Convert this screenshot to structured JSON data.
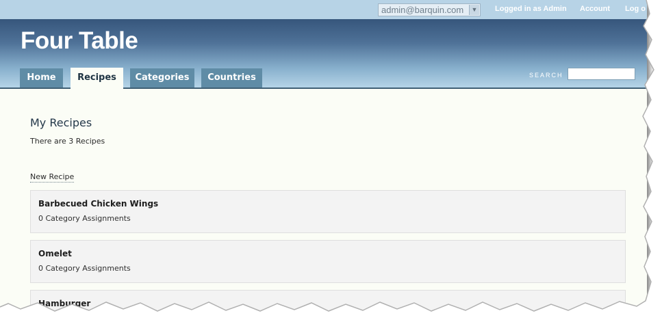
{
  "topbar": {
    "user_select": {
      "value": "admin@barquin.com"
    },
    "logged_in": "Logged in as Admin",
    "account": "Account",
    "logout": "Log o"
  },
  "header": {
    "site_title": "Four Table",
    "tabs": [
      {
        "label": "Home",
        "active": false
      },
      {
        "label": "Recipes",
        "active": true
      },
      {
        "label": "Categories",
        "active": false
      },
      {
        "label": "Countries",
        "active": false
      }
    ],
    "search": {
      "label": "SEARCH",
      "value": "",
      "placeholder": ""
    }
  },
  "main": {
    "title": "My Recipes",
    "count_text": "There are 3 Recipes",
    "new_link": "New Recipe",
    "recipes": [
      {
        "name": "Barbecued Chicken Wings",
        "assignments": "0 Category Assignments"
      },
      {
        "name": "Omelet",
        "assignments": "0 Category Assignments"
      },
      {
        "name": "Hamburger",
        "assignments": ""
      }
    ]
  },
  "colors": {
    "header_dark": "#36567c",
    "header_light": "#b5d4e7",
    "tab_bg": "#5f8ca6",
    "page_bg": "#fbfdf6",
    "card_bg": "#f3f3f3"
  }
}
